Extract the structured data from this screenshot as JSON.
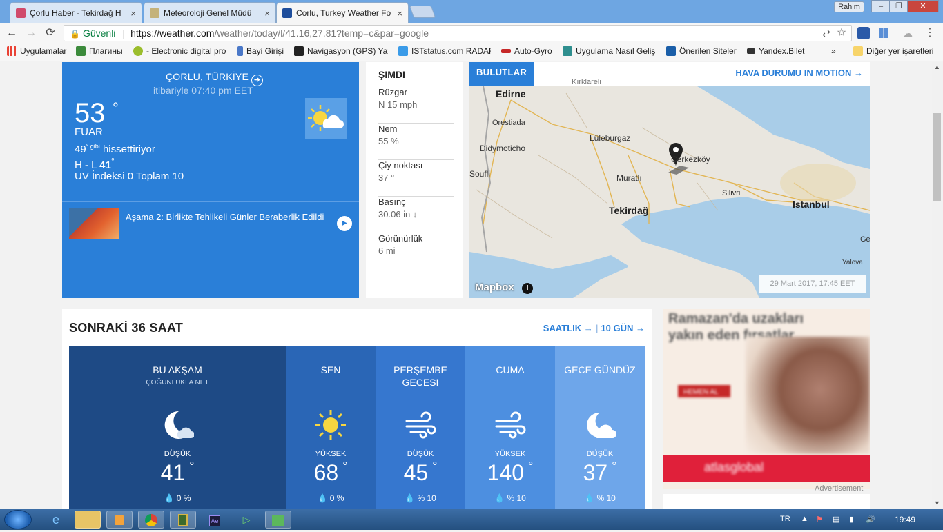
{
  "browser": {
    "tabs": [
      {
        "title": "Çorlu Haber - Tekirdağ H",
        "close": "×",
        "fav": "#d04a6b"
      },
      {
        "title": "Meteoroloji Genel Müdü",
        "close": "×",
        "fav": "#c4b27a"
      },
      {
        "title": "Corlu, Turkey Weather Fo",
        "close": "×",
        "fav": "#1f4e9c"
      }
    ],
    "user": "Rahim",
    "window_buttons": [
      "–",
      "❐",
      "✕"
    ],
    "nav": {
      "back": "←",
      "forward": "→",
      "reload": "⟳"
    },
    "omnibox": {
      "lock": "🔒",
      "secure_label": "Güvenli",
      "divider": "|",
      "host": "https://weather.com",
      "path": "/weather/today/l/41.16,27.81?temp=c&par=google"
    },
    "toolbar_icons": {
      "translate": "⇄",
      "star": "☆",
      "menu": "⋮"
    },
    "bookmarks": [
      {
        "label": "Uygulamalar",
        "color": "#e94235"
      },
      {
        "label": "Плагины",
        "color": "#3c8b3c"
      },
      {
        "label": "- Electronic digital pro",
        "color": "#9bbd2c"
      },
      {
        "label": "Bayi Girişi",
        "color": "#4a78c8"
      },
      {
        "label": "Navigasyon (GPS) Yaz",
        "color": "#222222"
      },
      {
        "label": "ISTstatus.com RADAR",
        "color": "#3a9be8"
      },
      {
        "label": "Auto-Gyro",
        "color": "#c62828"
      },
      {
        "label": "Uygulama Nasıl Geliş",
        "color": "#2f8f8f"
      },
      {
        "label": "Önerilen Siteler",
        "color": "#1a5ea8"
      },
      {
        "label": "Yandex.Bilet",
        "color": "#333333"
      }
    ],
    "bookmarks_more": "»",
    "other_bookmarks": "Diğer yer işaretleri"
  },
  "current": {
    "location": "ÇORLU, TÜRKİYE",
    "loc_arrow": "➜",
    "as_of": "itibariyle 07:40 pm EET",
    "temp": "53",
    "deg": "°",
    "phrase": "FUAR",
    "feels_value": "49",
    "feels_unit": "° gibi",
    "feels_label": "hissettiriyor",
    "hl_prefix": "H - L",
    "hl_value": "41",
    "hl_deg": "°",
    "uv": "UV İndeksi 0 Toplam 10",
    "icon": "partly-sunny-icon",
    "news_title": "Aşama 2: Birlikte Tehlikeli Günler Beraberlik Edildi",
    "news_play": "▶"
  },
  "now": {
    "title": "ŞIMDI",
    "items": [
      {
        "label": "Rüzgar",
        "value": "N 15 mph"
      },
      {
        "label": "Nem",
        "value": "55 %"
      },
      {
        "label": "Çiy noktası",
        "value": "37 °"
      },
      {
        "label": "Basınç",
        "value": "30.06 in ↓"
      },
      {
        "label": "Görünürlük",
        "value": "6 mi"
      }
    ]
  },
  "map": {
    "tab": "BULUTLAR",
    "motion": "HAVA DURUMU IN MOTION →",
    "labels": {
      "edirne": "Edirne",
      "orestiada": "Orestiada",
      "didymoticho": "Didymoticho",
      "soufli": "Soufli",
      "luleburgaz": "Lüleburgaz",
      "cerkezkoy": "Çerkezköy",
      "muratli": "Muratlı",
      "tekirdag": "Tekirdağ",
      "silivri": "Silivri",
      "istanbul": "Istanbul",
      "yalova": "Yalova",
      "ge": "Ge",
      "kirklareli": "Kırklareli"
    },
    "mapbox": "Mapbox",
    "info": "i",
    "stamp": "29 Mart 2017, 17:45 EET"
  },
  "next36": {
    "title": "SONRAKİ 36 SAAT",
    "link_hourly": "SAATLIK →",
    "link_10day": "10 GÜN →",
    "link_divider": "|",
    "periods": [
      {
        "name": "BU AKŞAM",
        "sub": "ÇOĞUNLUKLA NET",
        "icon": "moon-cloud-icon",
        "level": "DÜŞÜK",
        "temp": "41",
        "deg": "°",
        "precip": "0 %",
        "color": "#1e4a85"
      },
      {
        "name": "SEN",
        "sub": "",
        "icon": "sun-icon",
        "level": "YÜKSEK",
        "temp": "68",
        "deg": "°",
        "precip": "0 %",
        "color": "#2a66b6"
      },
      {
        "name": "PERŞEMBE GECESI",
        "sub": "",
        "icon": "wind-icon",
        "level": "DÜŞÜK",
        "temp": "45",
        "deg": "°",
        "precip": "% 10",
        "color": "#3677cf"
      },
      {
        "name": "CUMA",
        "sub": "",
        "icon": "wind-icon",
        "level": "YÜKSEK",
        "temp": "140",
        "deg": "°",
        "precip": "% 10",
        "color": "#4d8fe0"
      },
      {
        "name": "GECE GÜNDÜZ",
        "sub": "",
        "icon": "cloud-sun-icon",
        "level": "DÜŞÜK",
        "temp": "37",
        "deg": "°",
        "precip": "% 10",
        "color": "#6ea6ea"
      }
    ]
  },
  "ad": {
    "headline": "Ramazan'da uzakları yakın eden fırsatlar",
    "button": "HEMEN AL",
    "brand": "atlasglobal",
    "label": "Advertisement"
  },
  "taskbar": {
    "lang": "TR",
    "clock": "19:49"
  }
}
